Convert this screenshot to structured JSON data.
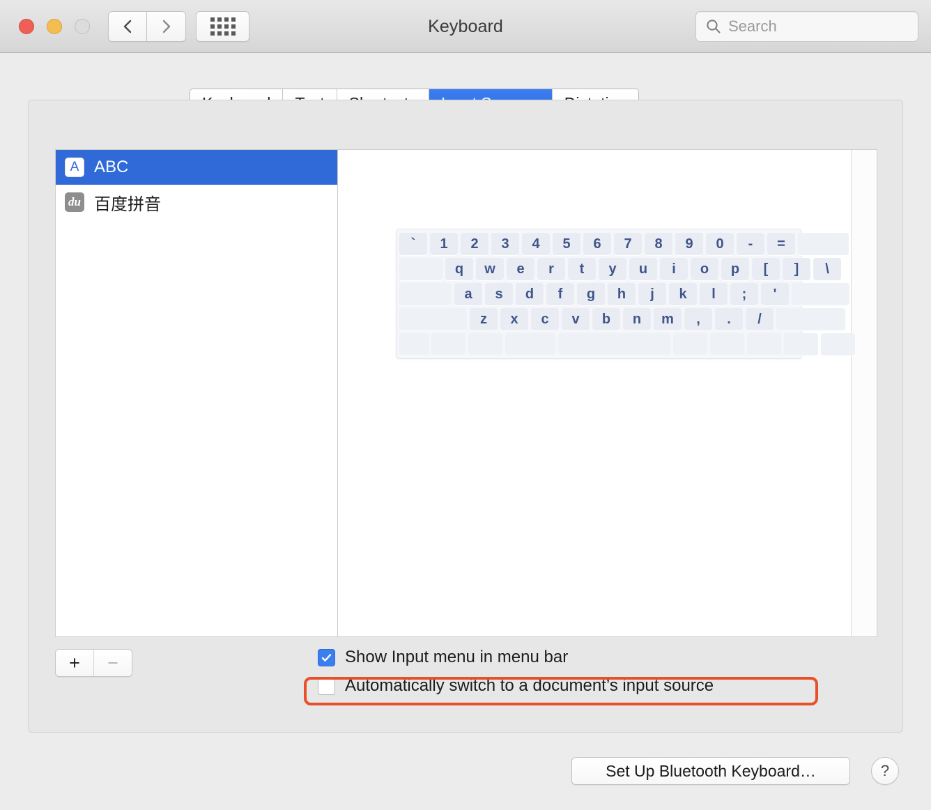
{
  "window": {
    "title": "Keyboard",
    "traffic_lights": [
      "close",
      "minimize",
      "zoom"
    ],
    "nav_back_icon": "chevron-left-icon",
    "nav_forward_icon": "chevron-right-icon",
    "grid_icon": "show-all-grid-icon"
  },
  "search": {
    "placeholder": "Search",
    "value": "",
    "icon": "search-icon"
  },
  "tabs": [
    {
      "label": "Keyboard",
      "active": false
    },
    {
      "label": "Text",
      "active": false
    },
    {
      "label": "Shortcuts",
      "active": false
    },
    {
      "label": "Input Sources",
      "active": true
    },
    {
      "label": "Dictation",
      "active": false
    }
  ],
  "input_sources": [
    {
      "label": "ABC",
      "icon_text": "A",
      "icon_kind": "abc",
      "selected": true
    },
    {
      "label": "百度拼音",
      "icon_text": "du",
      "icon_kind": "du",
      "selected": false
    }
  ],
  "list_buttons": {
    "add_label": "+",
    "remove_label": "−",
    "add_enabled": true,
    "remove_enabled": false
  },
  "keyboard_preview": {
    "rows": [
      {
        "keys": [
          "`",
          "1",
          "2",
          "3",
          "4",
          "5",
          "6",
          "7",
          "8",
          "9",
          "0",
          "-",
          "="
        ],
        "trailing_blank_widths": [
          73
        ]
      },
      {
        "leading_blank_widths": [
          73
        ],
        "keys": [
          "q",
          "w",
          "e",
          "r",
          "t",
          "y",
          "u",
          "i",
          "o",
          "p",
          "[",
          "]",
          "\\"
        ]
      },
      {
        "leading_blank_widths": [
          86
        ],
        "keys": [
          "a",
          "s",
          "d",
          "f",
          "g",
          "h",
          "j",
          "k",
          "l",
          ";",
          "'"
        ],
        "trailing_blank_widths": [
          83
        ]
      },
      {
        "leading_blank_widths": [
          107
        ],
        "keys": [
          "z",
          "x",
          "c",
          "v",
          "b",
          "n",
          "m",
          ",",
          ".",
          "/"
        ],
        "trailing_blank_widths": [
          109
        ]
      },
      {
        "modifier_widths": [
          40,
          49,
          49,
          62
        ],
        "space_width": 200,
        "right_widths": [
          49,
          49,
          49
        ],
        "arrow_split_width": 49,
        "last_width": 49
      }
    ]
  },
  "checkboxes": [
    {
      "label": "Show Input menu in menu bar",
      "checked": true
    },
    {
      "label": "Automatically switch to a document’s input source",
      "checked": false,
      "highlighted": true
    }
  ],
  "footer": {
    "bluetooth_button": "Set Up Bluetooth Keyboard…",
    "help_button": "?"
  },
  "colors": {
    "accent_blue": "#3b7ef0",
    "selection_blue": "#2f6ad8",
    "highlight_orange": "#e8502a",
    "key_text": "#41558c",
    "window_bg": "#ececec"
  }
}
